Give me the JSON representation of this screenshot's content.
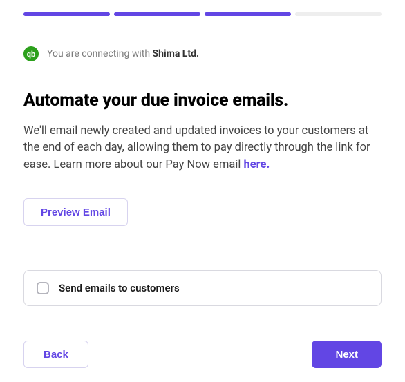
{
  "progress": {
    "total": 4,
    "completed": 3
  },
  "connect": {
    "badge_text": "qb",
    "prefix": "You are connecting with ",
    "company": "Shima Ltd."
  },
  "heading": "Automate your due invoice emails.",
  "body": {
    "text": "We'll email newly created and updated invoices to your customers at the end of each day, allowing them to pay directly through the link for ease. Learn more about our Pay Now email ",
    "link_text": "here."
  },
  "preview_label": "Preview Email",
  "checkbox": {
    "label": "Send emails to customers",
    "checked": false
  },
  "footer": {
    "back": "Back",
    "next": "Next"
  },
  "colors": {
    "accent": "#6246e4",
    "badge": "#2ca01c"
  }
}
